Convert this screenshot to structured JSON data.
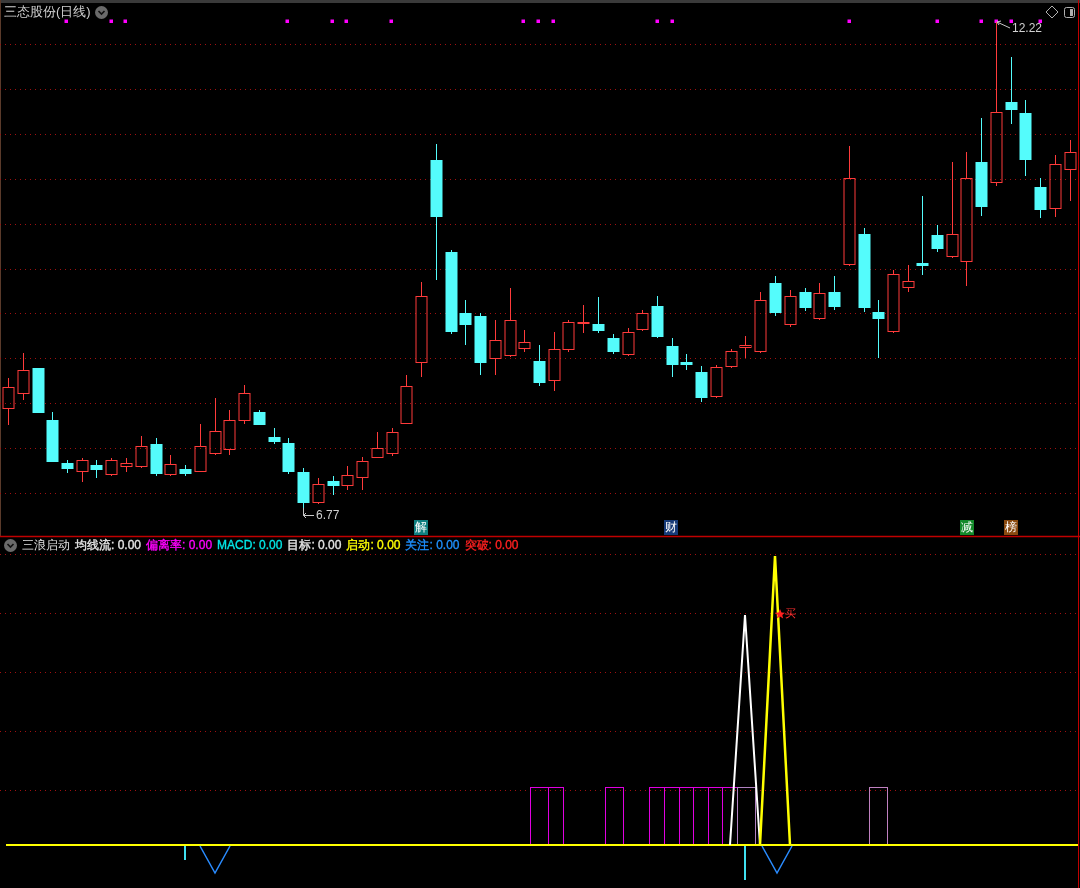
{
  "main_chart": {
    "title": "三态股份(日线)",
    "price_labels": [
      {
        "kind": "low",
        "text": "6.77"
      },
      {
        "kind": "high",
        "text": "12.22"
      }
    ],
    "event_tags": [
      {
        "text": "解",
        "color": "#0f7f80"
      },
      {
        "text": "财",
        "color": "#163a78"
      },
      {
        "text": "减",
        "color": "#138a2a"
      },
      {
        "text": "榜",
        "color": "#8a4a10"
      }
    ]
  },
  "indicator_panel": {
    "name": "三浪启动",
    "values": [
      {
        "label": "均线流:",
        "value": "0.00",
        "color": "#e6e6e6"
      },
      {
        "label": "偏离率:",
        "value": "0.00",
        "color": "#ff00ff"
      },
      {
        "label": "MACD:",
        "value": "0.00",
        "color": "#00e6e6"
      },
      {
        "label": "目标:",
        "value": "0.00",
        "color": "#e6e6e6"
      },
      {
        "label": "启动:",
        "value": "0.00",
        "color": "#ffff00"
      },
      {
        "label": "关注:",
        "value": "0.00",
        "color": "#1e90ff"
      },
      {
        "label": "突破:",
        "value": "0.00",
        "color": "#ff2020"
      }
    ],
    "signal": {
      "text": "买"
    }
  }
}
